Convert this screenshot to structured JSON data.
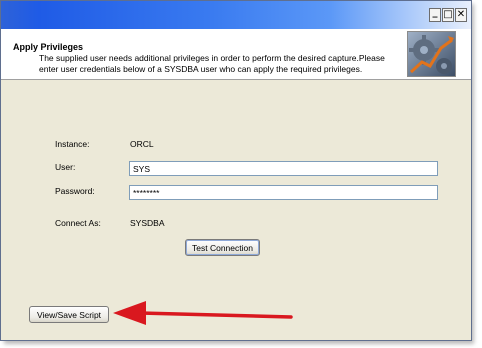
{
  "window": {
    "title": "",
    "controls": {
      "minimize": "_",
      "maximize": "□",
      "close": "✕"
    }
  },
  "header": {
    "title": "Apply Privileges",
    "description": "The supplied user needs additional privileges in order to perform the desired capture.Please enter user credentials below of a SYSDBA user who can apply the required privileges."
  },
  "form": {
    "instance_label": "Instance:",
    "instance_value": "ORCL",
    "user_label": "User:",
    "user_value": "SYS",
    "password_label": "Password:",
    "password_value": "********",
    "connect_as_label": "Connect As:",
    "connect_as_value": "SYSDBA",
    "test_connection_label": "Test Connection"
  },
  "footer": {
    "view_save_script_label": "View/Save Script"
  },
  "colors": {
    "annotation_arrow": "#d9181f",
    "titlebar": "#2e62d8",
    "window_bg": "#ece9d8"
  }
}
